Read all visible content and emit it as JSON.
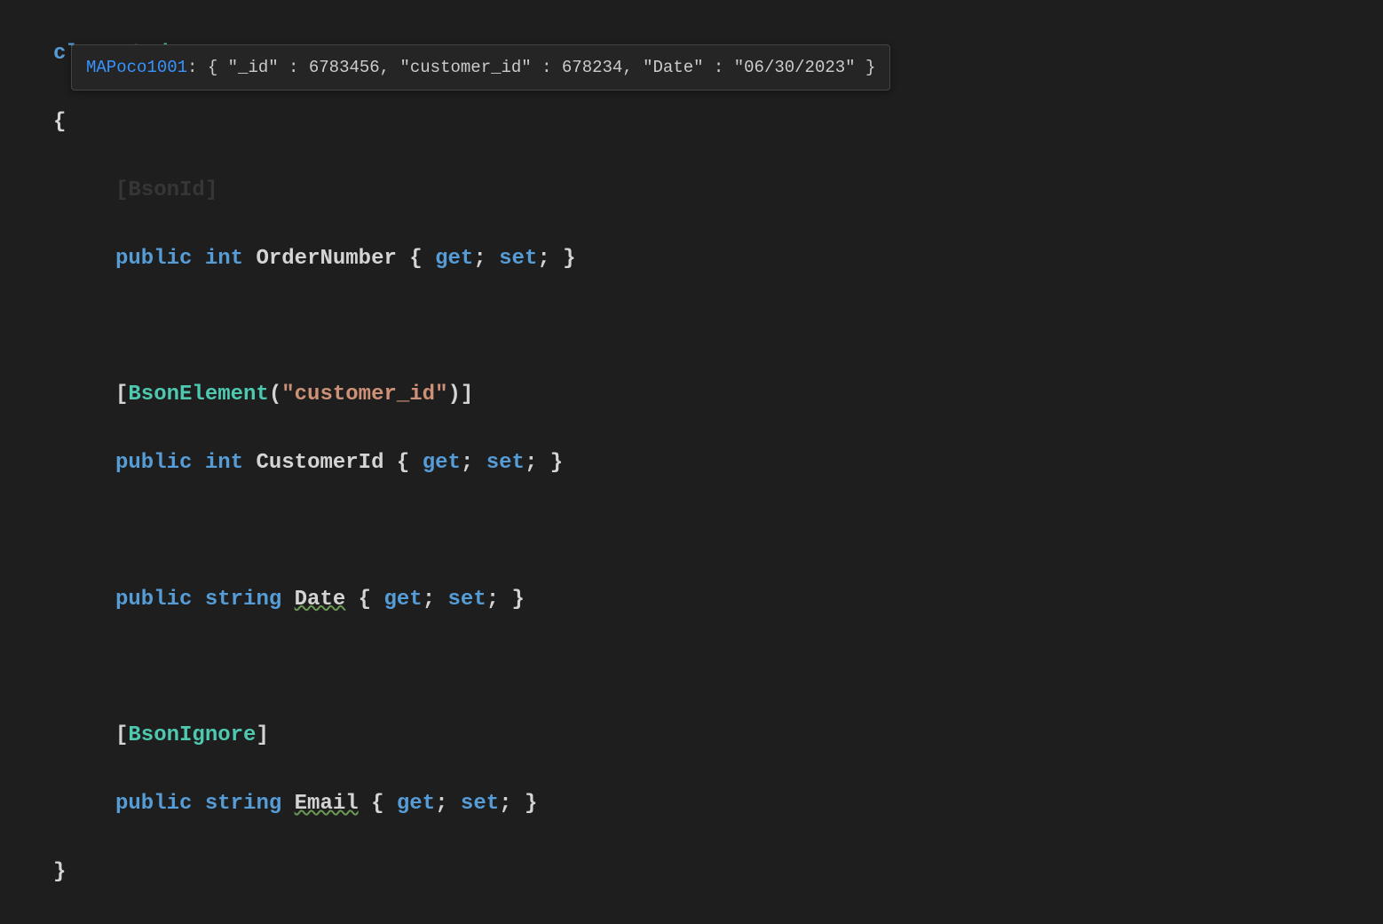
{
  "tooltip": {
    "code": "MAPoco1001",
    "sep": ": ",
    "content": "{ \"_id\" : 6783456, \"customer_id\" : 678234, \"Date\" : \"06/30/2023\" }"
  },
  "code": {
    "line1_class": "class",
    "line1_name": "Order",
    "line2_brace": "{",
    "line3_bracket_open": "[",
    "line3_attr": "BsonId",
    "line3_bracket_close": "]",
    "line4_public": "public",
    "line4_type": "int",
    "line4_name": "OrderNumber",
    "line4_bodyopen": " { ",
    "line4_get": "get",
    "line4_semi1": "; ",
    "line4_set": "set",
    "line4_semi2": "; }",
    "line6_bracket_open": "[",
    "line6_attr": "BsonElement",
    "line6_paren_open": "(",
    "line6_string": "\"customer_id\"",
    "line6_paren_close": ")",
    "line6_bracket_close": "]",
    "line7_public": "public",
    "line7_type": "int",
    "line7_name": "CustomerId",
    "line7_bodyopen": " { ",
    "line7_get": "get",
    "line7_semi1": "; ",
    "line7_set": "set",
    "line7_semi2": "; }",
    "line9_public": "public",
    "line9_type": "string",
    "line9_name": "Date",
    "line9_bodyopen": " { ",
    "line9_get": "get",
    "line9_semi1": "; ",
    "line9_set": "set",
    "line9_semi2": "; }",
    "line11_bracket_open": "[",
    "line11_attr": "BsonIgnore",
    "line11_bracket_close": "]",
    "line12_public": "public",
    "line12_type": "string",
    "line12_name": "Email",
    "line12_bodyopen": " { ",
    "line12_get": "get",
    "line12_semi1": "; ",
    "line12_set": "set",
    "line12_semi2": "; }",
    "line13_brace": "}"
  }
}
